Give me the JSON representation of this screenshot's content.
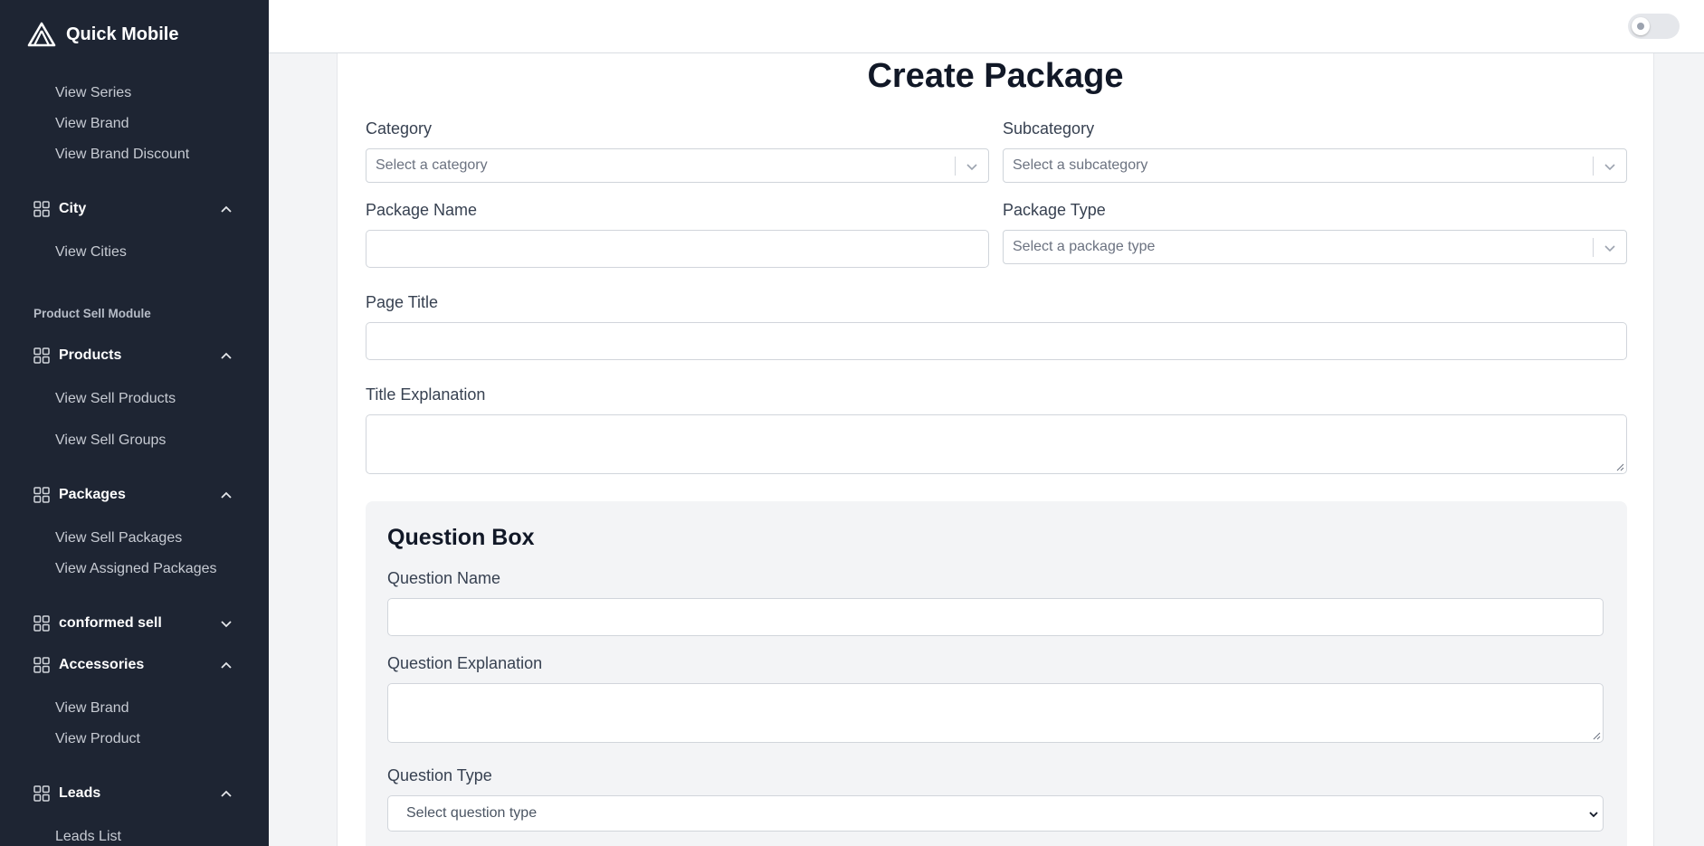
{
  "sidebar": {
    "brand": "Quick Mobile",
    "links_top": [
      "View Series",
      "View Brand",
      "View Brand Discount"
    ],
    "city": {
      "label": "City",
      "items": [
        "View Cities"
      ]
    },
    "section_title": "Product Sell Module",
    "products": {
      "label": "Products",
      "items": [
        "View Sell Products",
        "View Sell Groups"
      ]
    },
    "packages": {
      "label": "Packages",
      "items": [
        "View Sell Packages",
        "View Assigned Packages"
      ]
    },
    "conformed": {
      "label": "conformed sell"
    },
    "accessories": {
      "label": "Accessories",
      "items": [
        "View Brand",
        "View Product"
      ]
    },
    "leads": {
      "label": "Leads",
      "items": [
        "Leads List"
      ]
    }
  },
  "page": {
    "title": "Create Package"
  },
  "form": {
    "category_label": "Category",
    "category_placeholder": "Select a category",
    "subcategory_label": "Subcategory",
    "subcategory_placeholder": "Select a subcategory",
    "package_name_label": "Package Name",
    "package_type_label": "Package Type",
    "package_type_placeholder": "Select a package type",
    "page_title_label": "Page Title",
    "title_explanation_label": "Title Explanation"
  },
  "question_box": {
    "title": "Question Box",
    "question_name_label": "Question Name",
    "question_explanation_label": "Question Explanation",
    "question_type_label": "Question Type",
    "question_type_placeholder": "Select question type"
  },
  "colors": {
    "sidebar_bg": "#1e2533",
    "content_bg": "#f3f4f6",
    "card_bg": "#ffffff"
  }
}
